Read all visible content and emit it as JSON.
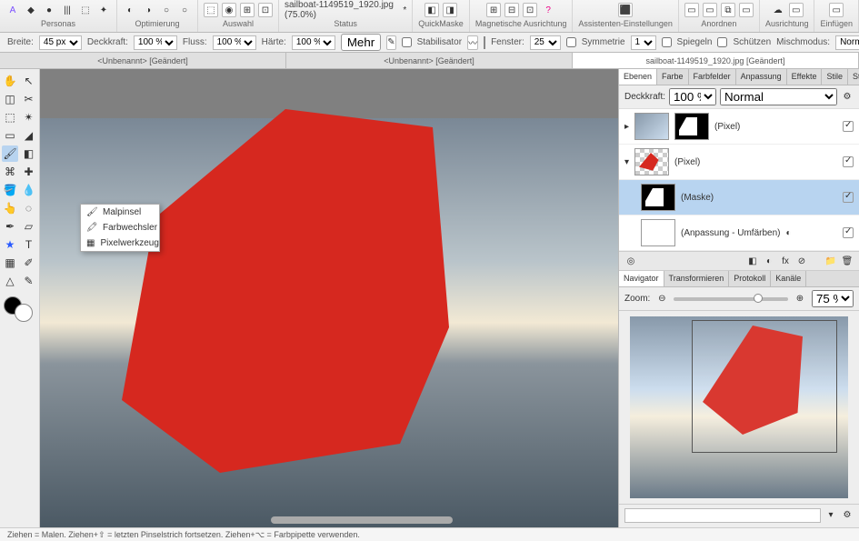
{
  "app_title": "sailboat-1149519_1920.jpg (75.0%)",
  "topbar_groups": [
    {
      "label": "Personas",
      "icons": [
        "◇",
        "◆",
        "●",
        "|||",
        "⬚",
        "✦"
      ]
    },
    {
      "label": "Optimierung",
      "icons": [
        "◐",
        "◑",
        "○",
        "○"
      ]
    },
    {
      "label": "Auswahl",
      "icons": [
        "⬚",
        "◉",
        "⊞",
        "⊡"
      ]
    },
    {
      "label": "Status",
      "icons": [
        "*"
      ],
      "title": "sailboat-1149519_1920.jpg (75.0%)"
    },
    {
      "label": "QuickMaske",
      "icons": [
        "◧",
        "◨"
      ]
    },
    {
      "label": "Magnetische Ausrichtung",
      "icons": [
        "⊞",
        "⊟",
        "⊡",
        "?"
      ]
    },
    {
      "label": "Assistenten-Einstellungen",
      "icons": [
        "⬛"
      ]
    },
    {
      "label": "Anordnen",
      "icons": [
        "▭",
        "▭",
        "⧉",
        "▭"
      ]
    },
    {
      "label": "Ausrichtung",
      "icons": [
        "☁",
        "▭"
      ]
    },
    {
      "label": "Einfügen",
      "icons": [
        "▭"
      ]
    }
  ],
  "options": {
    "breite_label": "Breite:",
    "breite": "45 px",
    "deckkraft_label": "Deckkraft:",
    "deckkraft": "100 %",
    "fluss_label": "Fluss:",
    "fluss": "100 %",
    "haerte_label": "Härte:",
    "haerte": "100 %",
    "mehr": "Mehr",
    "stabil": "Stabilisator",
    "fenster_label": "Fenster:",
    "fenster": "25",
    "symm_label": "Symmetrie",
    "symm": "1",
    "spiegeln": "Spiegeln",
    "schuetzen": "Schützen",
    "mischmodus_label": "Mischmodus:",
    "mischmodus": "Normal"
  },
  "doctabs": [
    {
      "label": "<Unbenannt> [Geändert]"
    },
    {
      "label": "<Unbenannt> [Geändert]"
    },
    {
      "label": "sailboat-1149519_1920.jpg [Geändert]",
      "active": true
    }
  ],
  "flyout": [
    {
      "icon": "🖌",
      "label": "Malpinsel"
    },
    {
      "icon": "🖍",
      "label": "Farbwechsler"
    },
    {
      "icon": "▦",
      "label": "Pixelwerkzeug"
    }
  ],
  "panel_tabs1": [
    "Ebenen",
    "Farbe",
    "Farbfelder",
    "Anpassung",
    "Effekte",
    "Stile",
    "Stock"
  ],
  "layer_opacity_label": "Deckkraft:",
  "layer_opacity": "100 %",
  "layer_blend": "Normal",
  "layers": [
    {
      "name": "(Pixel)",
      "thumb": "photo",
      "mask": true
    },
    {
      "name": "(Pixel)",
      "thumb": "red"
    },
    {
      "name": "(Maske)",
      "thumb": "mask",
      "sel": true,
      "indent": true
    },
    {
      "name": "(Anpassung - Umfärben)",
      "thumb": "white",
      "indent": true
    }
  ],
  "panel_tabs2": [
    "Navigator",
    "Transformieren",
    "Protokoll",
    "Kanäle"
  ],
  "zoom_label": "Zoom:",
  "zoom_value": "75 %",
  "status_text": "Ziehen = Malen. Ziehen+⇧ = letzten Pinselstrich fortsetzen. Ziehen+⌥ = Farbpipette verwenden."
}
